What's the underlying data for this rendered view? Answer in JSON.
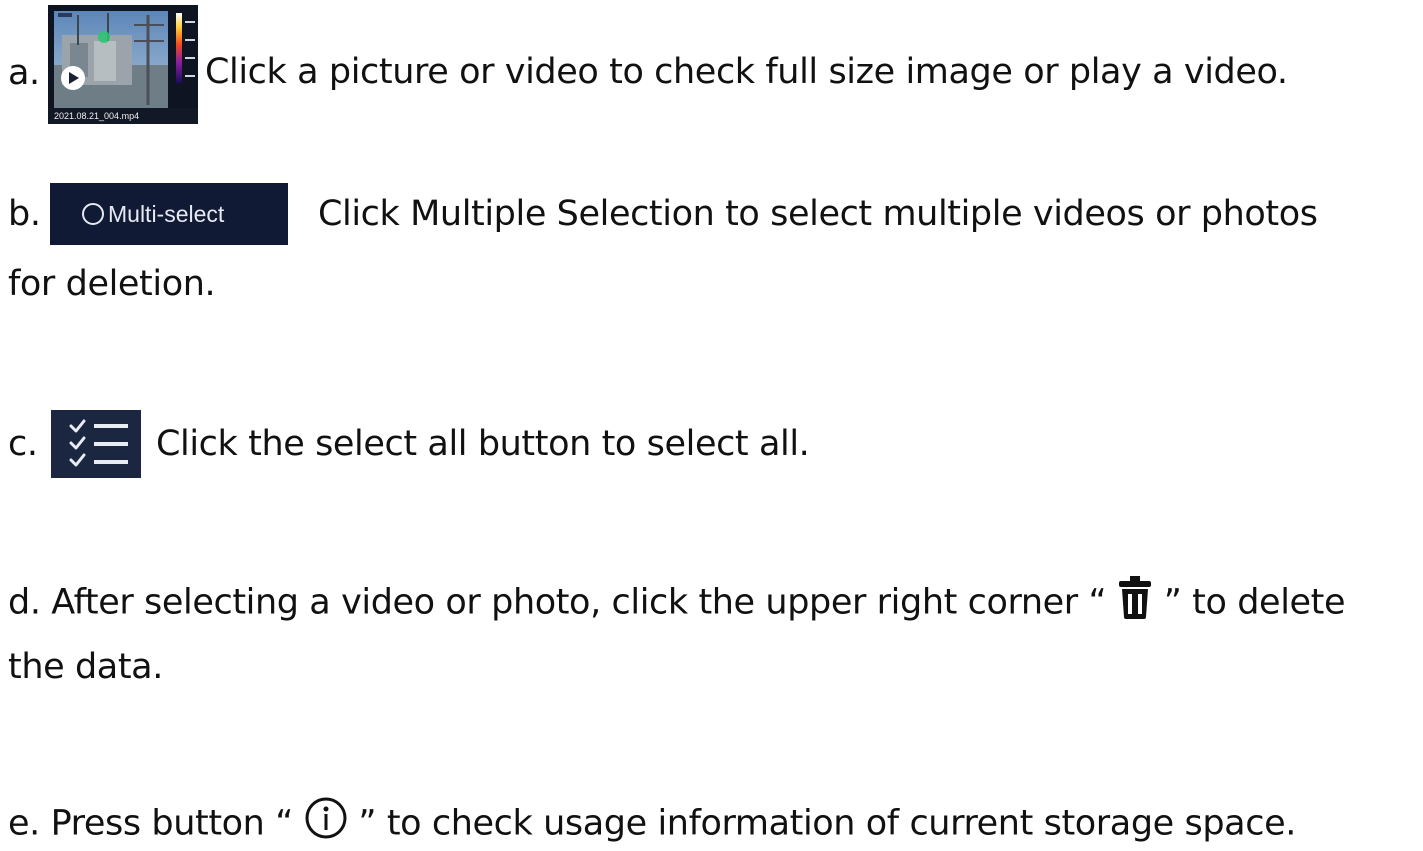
{
  "items": {
    "a": {
      "prefix": "a.",
      "text": "Click a picture or video to check full size image or play a video.",
      "thumbnail_caption": "2021.08.21_004.mp4"
    },
    "b": {
      "prefix": "b.",
      "button_label": "Multi-select",
      "text_line1": "Click Multiple Selection to select multiple videos or photos",
      "text_line2": "for deletion."
    },
    "c": {
      "prefix": "c.",
      "text": "Click the select all button to select all."
    },
    "d": {
      "prefix": "d.",
      "text_before": "After selecting a video or photo, click the upper right corner “",
      "text_after": "” to delete",
      "text_line2": "the data."
    },
    "e": {
      "text_before": "e. Press button “",
      "text_after": "” to check usage information of current storage space."
    }
  },
  "icons": {
    "thumbnail": "video-thumbnail-icon",
    "play": "play-icon",
    "multi_select_circle": "radio-circle-icon",
    "select_all": "checklist-icon",
    "delete": "trash-icon",
    "info": "info-icon"
  },
  "colors": {
    "text": "#111111",
    "button_bg": "#111a35",
    "icon_tile_bg": "#1b2640"
  }
}
